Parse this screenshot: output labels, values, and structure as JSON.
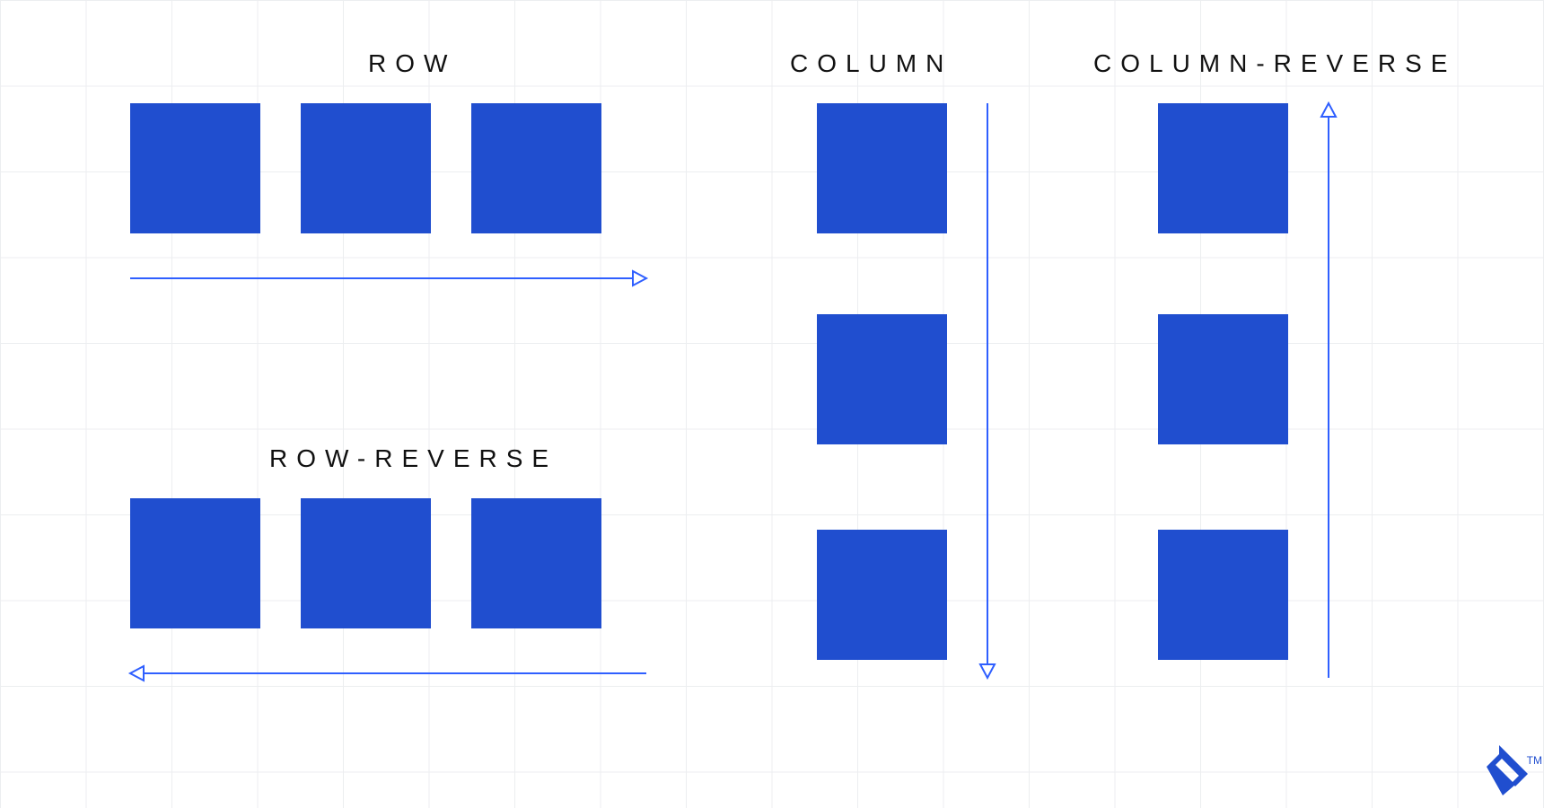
{
  "labels": {
    "row": "ROW",
    "row_reverse": "ROW-REVERSE",
    "column": "COLUMN",
    "column_reverse": "COLUMN-REVERSE"
  },
  "colors": {
    "box": "#204ECF",
    "arrow": "#2f5fff",
    "grid": "#eceef0"
  },
  "logo": {
    "trademark": "TM"
  },
  "diagram": {
    "groups": [
      {
        "name": "row",
        "layout": "horizontal",
        "boxes": 3,
        "arrow": "right"
      },
      {
        "name": "row-reverse",
        "layout": "horizontal",
        "boxes": 3,
        "arrow": "left"
      },
      {
        "name": "column",
        "layout": "vertical",
        "boxes": 3,
        "arrow": "down"
      },
      {
        "name": "column-reverse",
        "layout": "vertical",
        "boxes": 3,
        "arrow": "up"
      }
    ]
  }
}
